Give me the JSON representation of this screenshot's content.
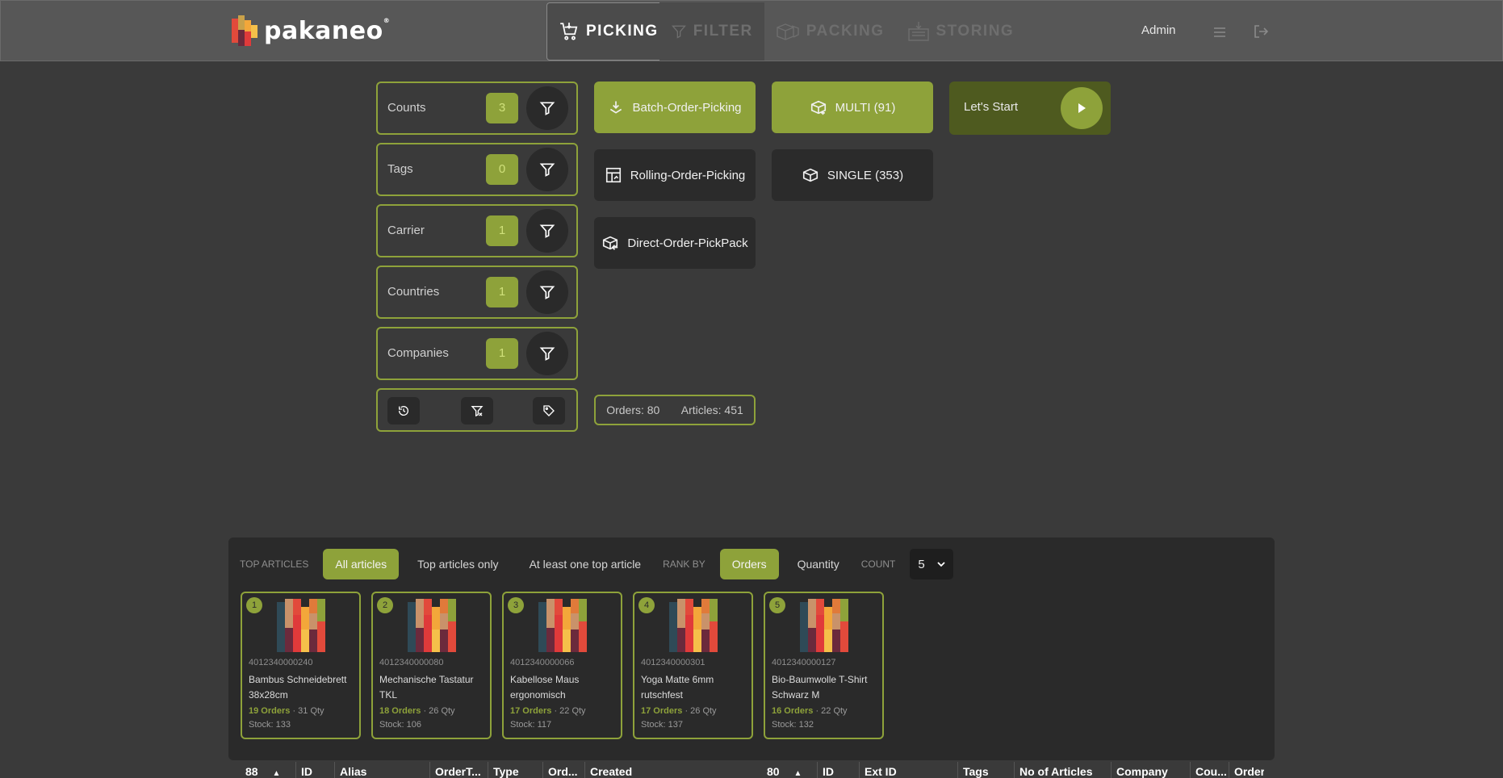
{
  "header": {
    "logo_text": "pakaneo",
    "tabs": [
      {
        "label": "PICKING",
        "icon": "cart-icon",
        "active": true
      },
      {
        "label": "FILTER",
        "icon": "filter-icon",
        "active": false
      },
      {
        "label": "PACKING",
        "icon": "box-icon",
        "active": false
      },
      {
        "label": "STORING",
        "icon": "storage-icon",
        "active": false
      }
    ],
    "user": "Admin"
  },
  "filters": [
    {
      "label": "Counts",
      "count": "3"
    },
    {
      "label": "Tags",
      "count": "0"
    },
    {
      "label": "Carrier",
      "count": "1"
    },
    {
      "label": "Countries",
      "count": "1"
    },
    {
      "label": "Companies",
      "count": "1"
    }
  ],
  "modes": {
    "batch": "Batch-Order-Picking",
    "multi": "MULTI (91)",
    "rolling": "Rolling-Order-Picking",
    "single": "SINGLE (353)",
    "direct": "Direct-Order-PickPack"
  },
  "start": {
    "label": "Let's Start"
  },
  "summary": {
    "orders": "Orders: 80",
    "articles": "Articles: 451"
  },
  "top_articles": {
    "caption": "TOP ARTICLES",
    "options": [
      "All articles",
      "Top articles only",
      "At least one top article"
    ],
    "rank_caption": "RANK BY",
    "rank_options": [
      "Orders",
      "Quantity"
    ],
    "count_caption": "COUNT",
    "count_value": "5",
    "items": [
      {
        "rank": "1",
        "sku": "4012340000240",
        "name": "Bambus Schneidebrett 38x28cm",
        "orders": "19 Orders",
        "qty": "· 31 Qty",
        "stock": "Stock: 133"
      },
      {
        "rank": "2",
        "sku": "4012340000080",
        "name": "Mechanische Tastatur TKL",
        "orders": "18 Orders",
        "qty": "· 26 Qty",
        "stock": "Stock: 106"
      },
      {
        "rank": "3",
        "sku": "4012340000066",
        "name": "Kabellose Maus ergonomisch",
        "orders": "17 Orders",
        "qty": "· 22 Qty",
        "stock": "Stock: 117"
      },
      {
        "rank": "4",
        "sku": "4012340000301",
        "name": "Yoga Matte 6mm rutschfest",
        "orders": "17 Orders",
        "qty": "· 26 Qty",
        "stock": "Stock: 137"
      },
      {
        "rank": "5",
        "sku": "4012340000127",
        "name": "Bio-Baumwolle T-Shirt Schwarz M",
        "orders": "16 Orders",
        "qty": "· 22 Qty",
        "stock": "Stock: 132"
      }
    ]
  },
  "table_left": {
    "columns": [
      "88",
      "ID",
      "Alias",
      "OrderT...",
      "Type",
      "Ord...",
      "Created"
    ]
  },
  "table_right": {
    "columns": [
      "80",
      "ID",
      "Ext ID",
      "Tags",
      "No of Articles",
      "Company",
      "Cou...",
      "Order"
    ]
  },
  "colors": {
    "accent": "#8ea23a",
    "panel": "#2a2a2a",
    "bg": "#3a3a3a"
  }
}
